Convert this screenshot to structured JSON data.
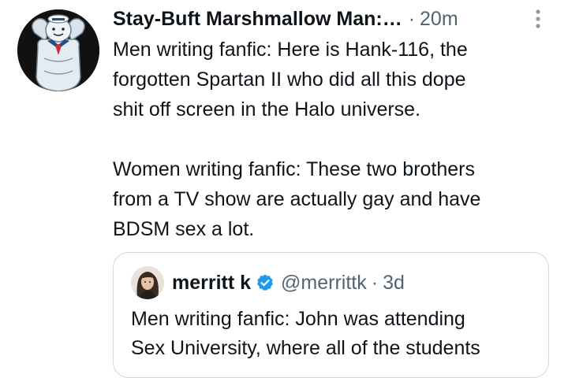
{
  "tweet": {
    "author_name": "Stay-Buft Marshmallow Man:…",
    "separator": "·",
    "time": "20m",
    "avatar_icon": "marshmallow-man-avatar",
    "text": "Men writing fanfic: Here is Hank-116, the\nforgotten Spartan II who did all this dope\nshit off screen in the Halo universe.\n\nWomen writing fanfic: These two brothers\nfrom a TV show are actually gay and have\nBDSM sex a lot."
  },
  "quoted_tweet": {
    "author_name": "merritt k",
    "handle": "@merrittk",
    "separator": "·",
    "time": "3d",
    "avatar_icon": "user-avatar",
    "verified_icon": "verified-badge-icon",
    "verified_color": "#1d9bf0",
    "text": "Men writing fanfic: John was attending\nSex University, where all of the students"
  },
  "icons": {
    "more": "more-options-icon"
  }
}
